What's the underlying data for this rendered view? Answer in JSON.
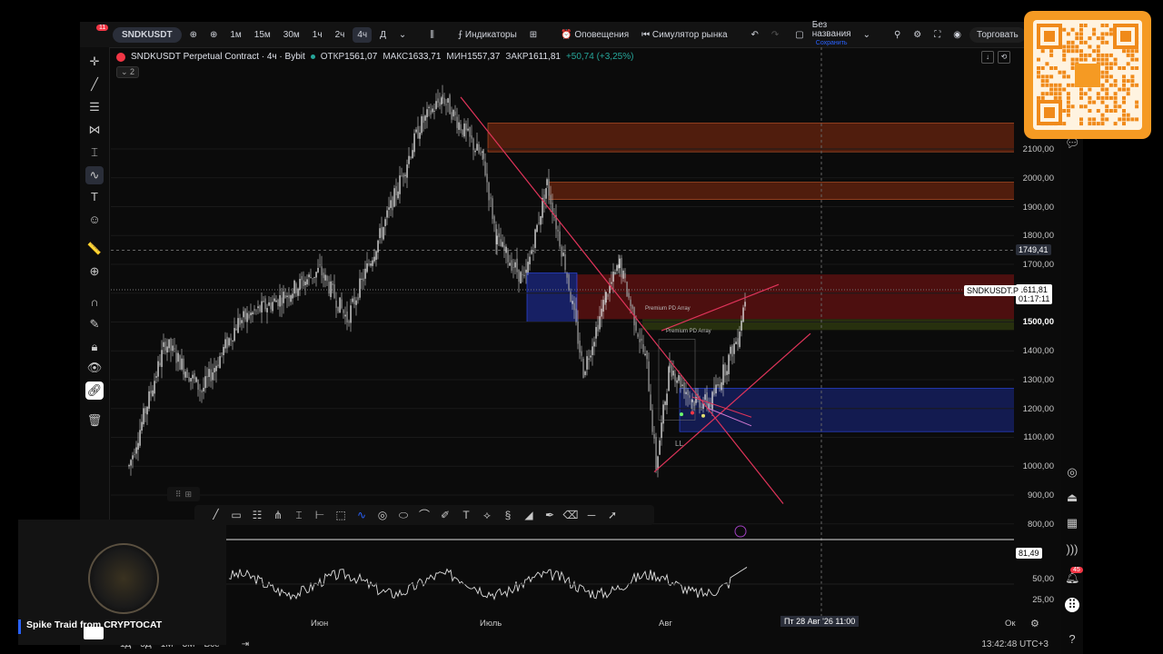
{
  "window": {
    "badge": "11"
  },
  "toolbar": {
    "symbol": "SNDKUSDT",
    "intervals": [
      "1м",
      "15м",
      "30м",
      "1ч",
      "2ч",
      "4ч",
      "Д"
    ],
    "active_interval": "4ч",
    "indicators": "Индикаторы",
    "alerts": "Оповещения",
    "replay": "Симулятор рынка",
    "layout_name": "Без названия",
    "layout_status": "Сохранить",
    "trade": "Торговать"
  },
  "legend": {
    "title": "SNDKUSDT Perpetual Contract · 4ч · Bybit",
    "open_label": "ОТКР",
    "open": "1561,07",
    "high_label": "МАКС",
    "high": "1633,71",
    "low_label": "МИН",
    "low": "1557,37",
    "close_label": "ЗАКР",
    "close": "1611,81",
    "change": "+50,74 (+3,25%)",
    "collapsed_count": "2"
  },
  "price_axis": {
    "labels": [
      "2100,00",
      "2000,00",
      "1900,00",
      "1800,00",
      "1700,00",
      "1500,00",
      "1400,00",
      "1300,00",
      "1200,00",
      "1100,00",
      "1000,00",
      "900,00",
      "800,00"
    ],
    "crosshair_price": "1749,41",
    "symbol_tag": "SNDKUSDT.P",
    "last_price": "1611,81",
    "countdown": "01:17:11",
    "partial_labels": [
      "2",
      "2",
      "2"
    ]
  },
  "oscillator_axis": {
    "labels": [
      "81,49",
      "50,00",
      "25,00"
    ]
  },
  "chart_annotations": {
    "pd_array_1": "Premium PD Array",
    "pd_array_2": "Premium PD Array",
    "ll_label": "LL"
  },
  "time_axis": {
    "labels": [
      "Июн",
      "Июль",
      "Авг"
    ],
    "crosshair_time": "Пт 28 Авг '26   11:00",
    "partial_right": "Ок"
  },
  "bottom": {
    "ranges": [
      "1Д",
      "5Д",
      "1М",
      "3М",
      "Все"
    ],
    "clock": "13:42:48 UTC+3"
  },
  "webcam": {
    "name": "Spike Traid from CRYPTOCAT"
  },
  "right_panel": {
    "notification_count": "45"
  },
  "colors": {
    "premium_zone": "#7a1212",
    "supply_zone": "#8a2e10",
    "demand_zone": "#1c2a8a",
    "trendline": "#e0345a",
    "up": "#26a69a",
    "accent": "#2962ff",
    "qr_frame": "#f59a23"
  },
  "chart_data": {
    "type": "candlestick",
    "ylim": [
      780,
      2280
    ],
    "oscillator_ylim": [
      0,
      100
    ],
    "zones": [
      {
        "type": "supply",
        "y1": 2190,
        "y2": 2090
      },
      {
        "type": "supply",
        "y1": 1985,
        "y2": 1925
      },
      {
        "type": "premium",
        "y1": 1665,
        "y2": 1510
      },
      {
        "type": "demand",
        "y1": 1270,
        "y2": 1120
      }
    ]
  }
}
